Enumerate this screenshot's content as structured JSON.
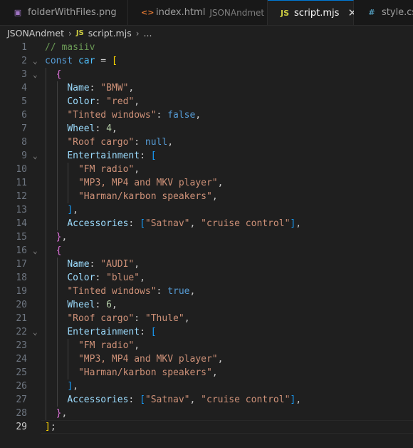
{
  "tabs": [
    {
      "label": "folderWithFiles.png",
      "icon": "image-file-icon",
      "icon_glyph": "▣",
      "icon_color": "#a074c4",
      "description": "",
      "active": false
    },
    {
      "label": "index.html",
      "icon": "html-file-icon",
      "icon_glyph": "<>",
      "icon_color": "#e37933",
      "description": "JSONAndmet",
      "active": false
    },
    {
      "label": "script.mjs",
      "icon": "js-file-icon",
      "icon_glyph": "JS",
      "icon_color": "#cbcb41",
      "description": "",
      "active": true,
      "close": "✕"
    },
    {
      "label": "style.css",
      "icon": "css-file-icon",
      "icon_glyph": "#",
      "icon_color": "#519aba",
      "description": "",
      "active": false
    }
  ],
  "breadcrumb": {
    "folder": "JSONAndmet",
    "file_icon": "JS",
    "file": "script.mjs",
    "ellipsis": "..."
  },
  "editor": {
    "current_line": 29,
    "colors": {
      "background": "#1f1f1f",
      "comment": "#6a9955",
      "keyword": "#569cd6",
      "string": "#ce9178",
      "number": "#b5cea8",
      "property": "#9cdcfe"
    },
    "lines": [
      {
        "n": "1",
        "fold": false,
        "indent": 0,
        "tokens": [
          [
            "comment",
            "// masiiv"
          ]
        ]
      },
      {
        "n": "2",
        "fold": true,
        "indent": 0,
        "tokens": [
          [
            "keyword",
            "const"
          ],
          [
            "plain",
            " "
          ],
          [
            "var",
            "car"
          ],
          [
            "plain",
            " = "
          ],
          [
            "b1",
            "["
          ]
        ]
      },
      {
        "n": "3",
        "fold": true,
        "indent": 1,
        "tokens": [
          [
            "plain",
            "  "
          ],
          [
            "b2",
            "{"
          ]
        ]
      },
      {
        "n": "4",
        "fold": false,
        "indent": 2,
        "tokens": [
          [
            "plain",
            "    "
          ],
          [
            "prop",
            "Name"
          ],
          [
            "plain",
            ": "
          ],
          [
            "string",
            "\"BMW\""
          ],
          [
            "plain",
            ","
          ]
        ]
      },
      {
        "n": "5",
        "fold": false,
        "indent": 2,
        "tokens": [
          [
            "plain",
            "    "
          ],
          [
            "prop",
            "Color"
          ],
          [
            "plain",
            ": "
          ],
          [
            "string",
            "\"red\""
          ],
          [
            "plain",
            ","
          ]
        ]
      },
      {
        "n": "6",
        "fold": false,
        "indent": 2,
        "tokens": [
          [
            "plain",
            "    "
          ],
          [
            "string",
            "\"Tinted windows\""
          ],
          [
            "plain",
            ": "
          ],
          [
            "keyword",
            "false"
          ],
          [
            "plain",
            ","
          ]
        ]
      },
      {
        "n": "7",
        "fold": false,
        "indent": 2,
        "tokens": [
          [
            "plain",
            "    "
          ],
          [
            "prop",
            "Wheel"
          ],
          [
            "plain",
            ": "
          ],
          [
            "number",
            "4"
          ],
          [
            "plain",
            ","
          ]
        ]
      },
      {
        "n": "8",
        "fold": false,
        "indent": 2,
        "tokens": [
          [
            "plain",
            "    "
          ],
          [
            "string",
            "\"Roof cargo\""
          ],
          [
            "plain",
            ": "
          ],
          [
            "keyword",
            "null"
          ],
          [
            "plain",
            ","
          ]
        ]
      },
      {
        "n": "9",
        "fold": true,
        "indent": 2,
        "tokens": [
          [
            "plain",
            "    "
          ],
          [
            "prop",
            "Entertainment"
          ],
          [
            "plain",
            ": "
          ],
          [
            "b3",
            "["
          ]
        ]
      },
      {
        "n": "10",
        "fold": false,
        "indent": 3,
        "tokens": [
          [
            "plain",
            "      "
          ],
          [
            "string",
            "\"FM radio\""
          ],
          [
            "plain",
            ","
          ]
        ]
      },
      {
        "n": "11",
        "fold": false,
        "indent": 3,
        "tokens": [
          [
            "plain",
            "      "
          ],
          [
            "string",
            "\"MP3, MP4 and MKV player\""
          ],
          [
            "plain",
            ","
          ]
        ]
      },
      {
        "n": "12",
        "fold": false,
        "indent": 3,
        "tokens": [
          [
            "plain",
            "      "
          ],
          [
            "string",
            "\"Harman/karbon speakers\""
          ],
          [
            "plain",
            ","
          ]
        ]
      },
      {
        "n": "13",
        "fold": false,
        "indent": 2,
        "tokens": [
          [
            "plain",
            "    "
          ],
          [
            "b3",
            "]"
          ],
          [
            "plain",
            ","
          ]
        ]
      },
      {
        "n": "14",
        "fold": false,
        "indent": 2,
        "tokens": [
          [
            "plain",
            "    "
          ],
          [
            "prop",
            "Accessories"
          ],
          [
            "plain",
            ": "
          ],
          [
            "b3",
            "["
          ],
          [
            "string",
            "\"Satnav\""
          ],
          [
            "plain",
            ", "
          ],
          [
            "string",
            "\"cruise control\""
          ],
          [
            "b3",
            "]"
          ],
          [
            "plain",
            ","
          ]
        ]
      },
      {
        "n": "15",
        "fold": false,
        "indent": 1,
        "tokens": [
          [
            "plain",
            "  "
          ],
          [
            "b2",
            "}"
          ],
          [
            "plain",
            ","
          ]
        ]
      },
      {
        "n": "16",
        "fold": true,
        "indent": 1,
        "tokens": [
          [
            "plain",
            "  "
          ],
          [
            "b2",
            "{"
          ]
        ]
      },
      {
        "n": "17",
        "fold": false,
        "indent": 2,
        "tokens": [
          [
            "plain",
            "    "
          ],
          [
            "prop",
            "Name"
          ],
          [
            "plain",
            ": "
          ],
          [
            "string",
            "\"AUDI\""
          ],
          [
            "plain",
            ","
          ]
        ]
      },
      {
        "n": "18",
        "fold": false,
        "indent": 2,
        "tokens": [
          [
            "plain",
            "    "
          ],
          [
            "prop",
            "Color"
          ],
          [
            "plain",
            ": "
          ],
          [
            "string",
            "\"blue\""
          ],
          [
            "plain",
            ","
          ]
        ]
      },
      {
        "n": "19",
        "fold": false,
        "indent": 2,
        "tokens": [
          [
            "plain",
            "    "
          ],
          [
            "string",
            "\"Tinted windows\""
          ],
          [
            "plain",
            ": "
          ],
          [
            "keyword",
            "true"
          ],
          [
            "plain",
            ","
          ]
        ]
      },
      {
        "n": "20",
        "fold": false,
        "indent": 2,
        "tokens": [
          [
            "plain",
            "    "
          ],
          [
            "prop",
            "Wheel"
          ],
          [
            "plain",
            ": "
          ],
          [
            "number",
            "6"
          ],
          [
            "plain",
            ","
          ]
        ]
      },
      {
        "n": "21",
        "fold": false,
        "indent": 2,
        "tokens": [
          [
            "plain",
            "    "
          ],
          [
            "string",
            "\"Roof cargo\""
          ],
          [
            "plain",
            ": "
          ],
          [
            "string",
            "\"Thule\""
          ],
          [
            "plain",
            ","
          ]
        ]
      },
      {
        "n": "22",
        "fold": true,
        "indent": 2,
        "tokens": [
          [
            "plain",
            "    "
          ],
          [
            "prop",
            "Entertainment"
          ],
          [
            "plain",
            ": "
          ],
          [
            "b3",
            "["
          ]
        ]
      },
      {
        "n": "23",
        "fold": false,
        "indent": 3,
        "tokens": [
          [
            "plain",
            "      "
          ],
          [
            "string",
            "\"FM radio\""
          ],
          [
            "plain",
            ","
          ]
        ]
      },
      {
        "n": "24",
        "fold": false,
        "indent": 3,
        "tokens": [
          [
            "plain",
            "      "
          ],
          [
            "string",
            "\"MP3, MP4 and MKV player\""
          ],
          [
            "plain",
            ","
          ]
        ]
      },
      {
        "n": "25",
        "fold": false,
        "indent": 3,
        "tokens": [
          [
            "plain",
            "      "
          ],
          [
            "string",
            "\"Harman/karbon speakers\""
          ],
          [
            "plain",
            ","
          ]
        ]
      },
      {
        "n": "26",
        "fold": false,
        "indent": 2,
        "tokens": [
          [
            "plain",
            "    "
          ],
          [
            "b3",
            "]"
          ],
          [
            "plain",
            ","
          ]
        ]
      },
      {
        "n": "27",
        "fold": false,
        "indent": 2,
        "tokens": [
          [
            "plain",
            "    "
          ],
          [
            "prop",
            "Accessories"
          ],
          [
            "plain",
            ": "
          ],
          [
            "b3",
            "["
          ],
          [
            "string",
            "\"Satnav\""
          ],
          [
            "plain",
            ", "
          ],
          [
            "string",
            "\"cruise control\""
          ],
          [
            "b3",
            "]"
          ],
          [
            "plain",
            ","
          ]
        ]
      },
      {
        "n": "28",
        "fold": false,
        "indent": 1,
        "tokens": [
          [
            "plain",
            "  "
          ],
          [
            "b2",
            "}"
          ],
          [
            "plain",
            ","
          ]
        ]
      },
      {
        "n": "29",
        "fold": false,
        "indent": 0,
        "tokens": [
          [
            "b1",
            "]"
          ],
          [
            "plain",
            ";"
          ]
        ]
      }
    ]
  }
}
